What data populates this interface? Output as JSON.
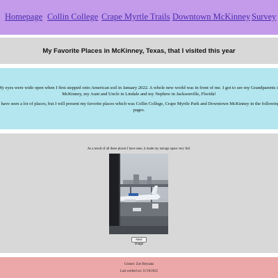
{
  "nav": {
    "items": [
      {
        "label": "Homepage"
      },
      {
        "label": "Collin College"
      },
      {
        "label": "Crape Myrtle Trails"
      },
      {
        "label": "Downtown McKinney"
      },
      {
        "label": "Survey"
      }
    ]
  },
  "header": {
    "title": "My Favorite Places in McKinney, Texas, that I visited this year"
  },
  "intro": {
    "paragraph1": "My eyes were wide open when I first stepped onto American soil in January 2022. A whole new world was in front of me. I got to see my Grandparents in McKinney, my Aunt and Uncle in Lindale and my Nephew in Jacksonville, Florida!",
    "paragraph2": "I have seen a lot of places, but I will present my favorite places which was Collin College, Crape Myrtle Park and Downtown McKinney in the following pages."
  },
  "gallery": {
    "caption": "As a result of all these places I have seen, it made my storage space very full.",
    "next_button": "Next image"
  },
  "footer": {
    "creator": "Creator: Zoe Heynana",
    "last_worked": "Last worked on: 11/18/2022"
  }
}
